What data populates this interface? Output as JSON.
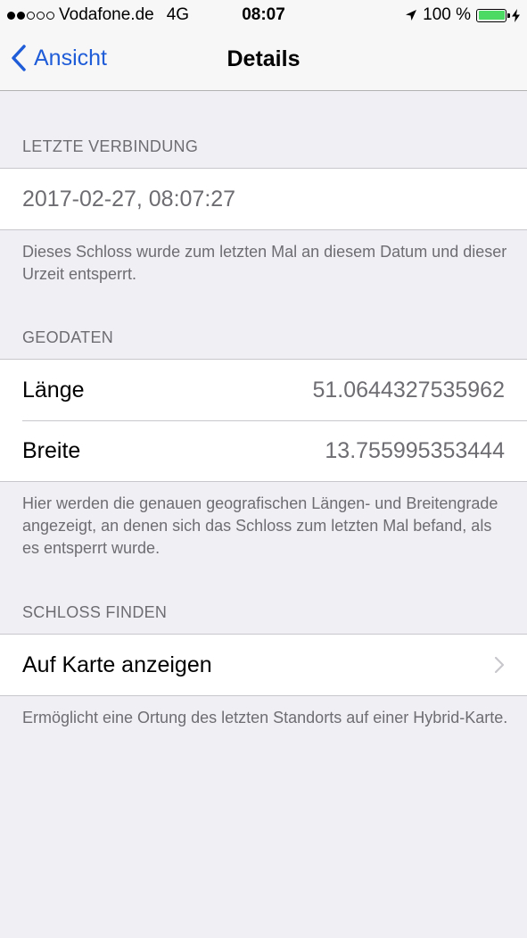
{
  "status_bar": {
    "carrier": "Vodafone.de",
    "network": "4G",
    "time": "08:07",
    "battery": "100 %",
    "signal_bars_filled": 2,
    "signal_bars_total": 5,
    "battery_level": 1.0,
    "battery_color": "#4cd964"
  },
  "nav": {
    "back_label": "Ansicht",
    "title": "Details",
    "accent_color": "#1f5cd8"
  },
  "sections": {
    "last_connection": {
      "header": "LETZTE VERBINDUNG",
      "value": "2017-02-27, 08:07:27",
      "footer": "Dieses Schloss wurde zum letzten Mal an diesem Datum und dieser Urzeit entsperrt."
    },
    "geodata": {
      "header": "GEODATEN",
      "rows": [
        {
          "label": "Länge",
          "value": "51.0644327535962"
        },
        {
          "label": "Breite",
          "value": "13.755995353444"
        }
      ],
      "footer": "Hier werden die genauen geografischen Längen- und Breitengrade angezeigt, an denen sich das Schloss zum letzten Mal befand, als es entsperrt wurde."
    },
    "find_lock": {
      "header": "SCHLOSS FINDEN",
      "action_label": "Auf Karte anzeigen",
      "footer": "Ermöglicht eine Ortung des letzten Standorts auf einer Hybrid-Karte."
    }
  }
}
